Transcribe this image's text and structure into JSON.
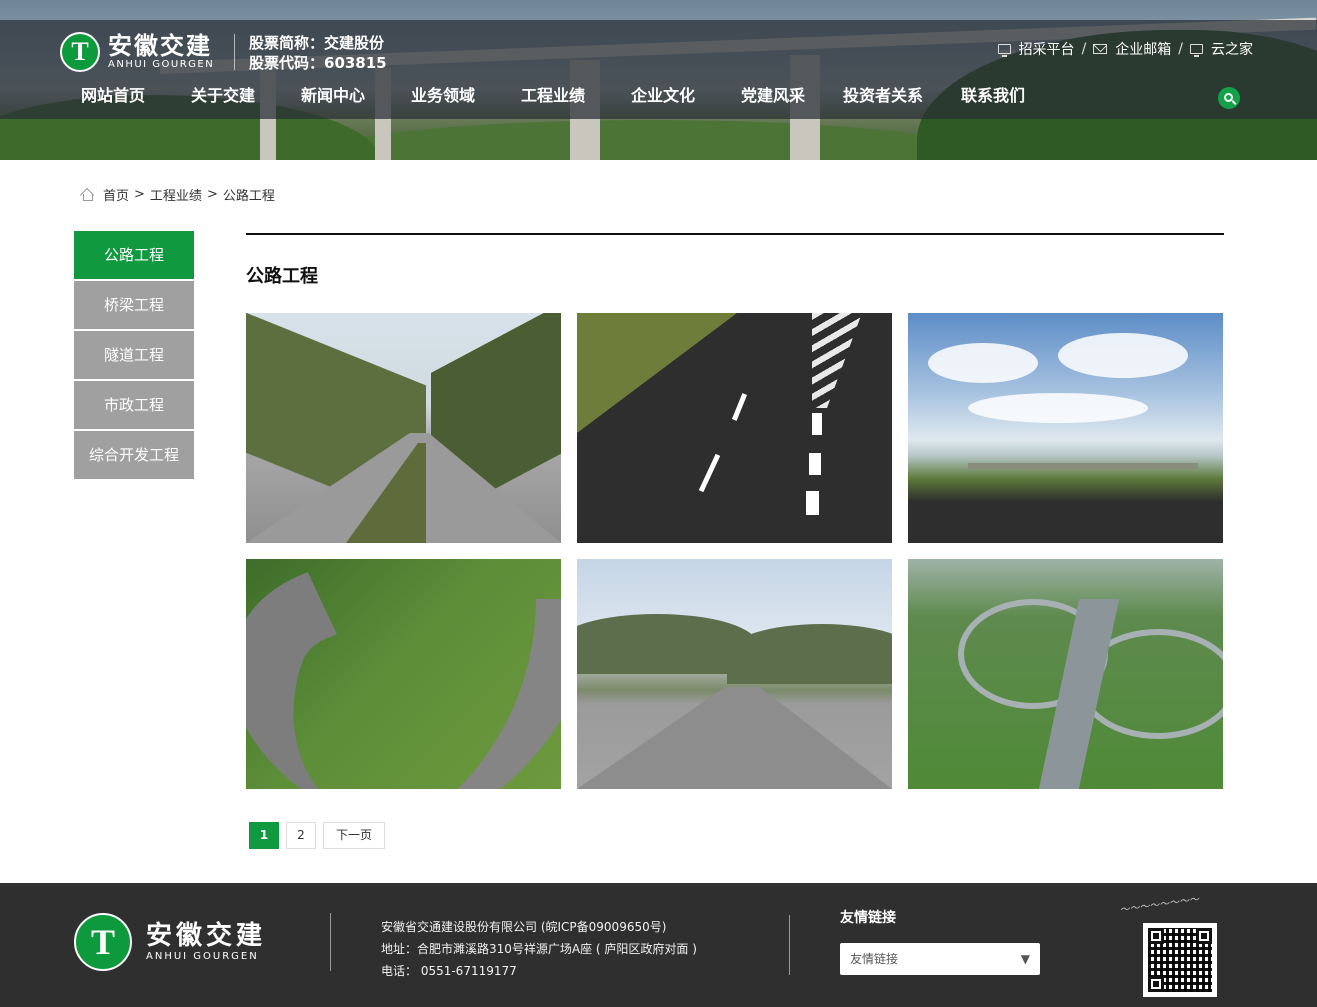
{
  "header": {
    "logo": {
      "cn": "安徽交建",
      "en": "ANHUI GOURGEN",
      "badge": "T"
    },
    "stock": {
      "abbr": "股票简称：交建股份",
      "code": "股票代码：603815"
    },
    "toplinks": [
      {
        "label": "招采平台",
        "icon": "monitor-icon"
      },
      {
        "label": "企业邮箱",
        "icon": "envelope-icon"
      },
      {
        "label": "云之家",
        "icon": "monitor-icon"
      }
    ],
    "slash": "/",
    "nav": [
      "网站首页",
      "关于交建",
      "新闻中心",
      "业务领域",
      "工程业绩",
      "企业文化",
      "党建风采",
      "投资者关系",
      "联系我们"
    ]
  },
  "breadcrumb": {
    "home": "首页",
    "level1": "工程业绩",
    "current": "公路工程",
    "sep": ">"
  },
  "sidebar": {
    "items": [
      {
        "label": "公路工程",
        "active": true
      },
      {
        "label": "桥梁工程",
        "active": false
      },
      {
        "label": "隧道工程",
        "active": false
      },
      {
        "label": "市政工程",
        "active": false
      },
      {
        "label": "综合开发工程",
        "active": false
      }
    ]
  },
  "content": {
    "title": "公路工程"
  },
  "pagination": {
    "pages": [
      "1",
      "2"
    ],
    "current": "1",
    "next": "下一页"
  },
  "footer": {
    "logo": {
      "cn": "安徽交建",
      "en": "ANHUI GOURGEN",
      "badge": "T"
    },
    "company": "安徽省交通建设股份有限公司 (皖ICP备09009650号)",
    "address": "地址：合肥市濉溪路310号祥源广场A座 ( 庐阳区政府对面 )",
    "phone": "电话： 0551-67119177",
    "links_title": "友情链接",
    "links_select": "友情链接",
    "select_arrow": "▼"
  },
  "colors": {
    "brand_green": "#11993f",
    "sidebar_gray": "#a0a0a0",
    "footer_bg": "#2f2f2f"
  }
}
